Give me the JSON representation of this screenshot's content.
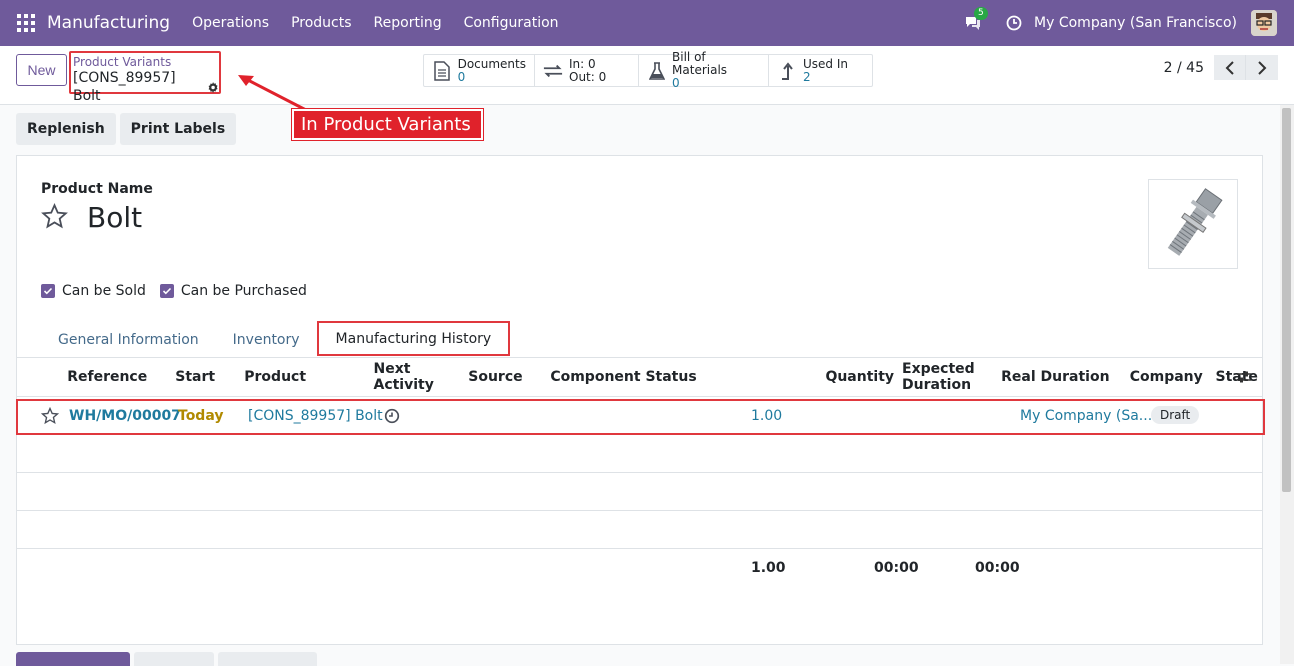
{
  "navbar": {
    "brand": "Manufacturing",
    "menu": [
      "Operations",
      "Products",
      "Reporting",
      "Configuration"
    ],
    "messages_count": "5",
    "company": "My Company (San Francisco)"
  },
  "control": {
    "new_label": "New",
    "breadcrumb_parent": "Product Variants",
    "breadcrumb_current": "[CONS_89957] Bolt",
    "stats": {
      "documents_label": "Documents",
      "documents_value": "0",
      "in_label": "In: 0",
      "out_label": "Out: 0",
      "bom_label": "Bill of Materials",
      "bom_value": "0",
      "usedin_label": "Used In",
      "usedin_value": "2"
    },
    "pager": "2 / 45"
  },
  "annotation": {
    "callout": "In Product Variants"
  },
  "actions": {
    "replenish": "Replenish",
    "print_labels": "Print Labels"
  },
  "form": {
    "product_name_label": "Product Name",
    "product_name": "Bolt",
    "can_be_sold": "Can be Sold",
    "can_be_purchased": "Can be Purchased",
    "tabs": [
      "General Information",
      "Inventory",
      "Manufacturing History"
    ]
  },
  "table": {
    "headers": [
      "Reference",
      "Start",
      "Product",
      "Next Activity",
      "Source",
      "Component Status",
      "Quantity",
      "Expected Duration",
      "Real Duration",
      "Company",
      "State"
    ],
    "row": {
      "reference": "WH/MO/00007",
      "start": "Today",
      "product": "[CONS_89957] Bolt",
      "quantity": "1.00",
      "company": "My Company (Sa...",
      "state": "Draft"
    },
    "totals": {
      "quantity": "1.00",
      "expected": "00:00",
      "real": "00:00"
    }
  }
}
